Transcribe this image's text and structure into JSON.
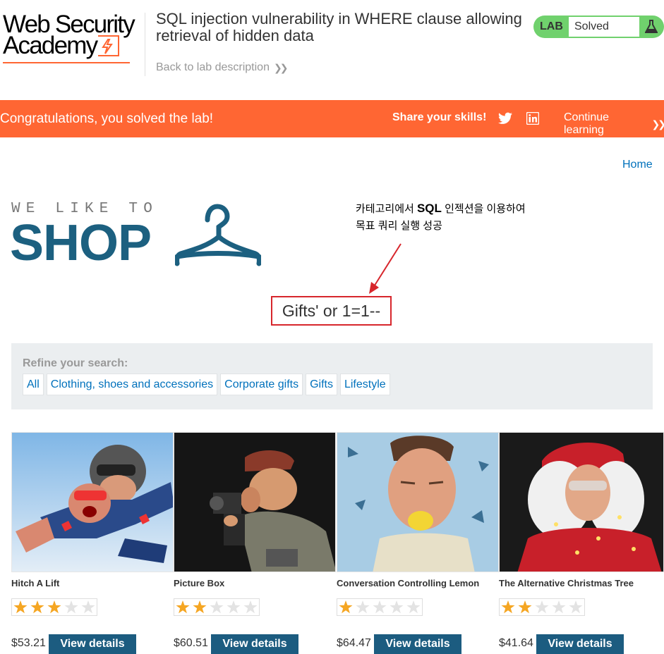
{
  "header": {
    "logo_line1": "Web Security",
    "logo_line2": "Academy",
    "lab_title": "SQL injection vulnerability in WHERE clause allowing retrieval of hidden data",
    "back_link": "Back to lab description",
    "lab_badge": "LAB",
    "lab_state": "Solved"
  },
  "banner": {
    "message": "Congratulations, you solved the lab!",
    "share": "Share your skills!",
    "continue": "Continue learning"
  },
  "nav": {
    "home": "Home"
  },
  "hero": {
    "tagline": "WE LIKE TO",
    "title": "SHOP"
  },
  "annotation": {
    "line1_pre": "카테고리에서 ",
    "line1_bold": "SQL",
    "line1_post": " 인젝션을 이용하여",
    "line2": "목표 쿼리 실행 성공"
  },
  "search": {
    "title": "Gifts' or 1=1--"
  },
  "filters": {
    "label": "Refine your search:",
    "items": [
      "All",
      "Clothing, shoes and accessories",
      "Corporate gifts",
      "Gifts",
      "Lifestyle"
    ]
  },
  "colors": {
    "brand_orange": "#ff6633",
    "lab_green": "#70d16d",
    "link_blue": "#0071bc",
    "button_blue": "#1c5c80",
    "annotation_red": "#d7262c",
    "star_gold": "#f5a623"
  },
  "products": [
    {
      "name": "Hitch A Lift",
      "rating": 3,
      "price": "$53.21",
      "button": "View details"
    },
    {
      "name": "Picture Box",
      "rating": 2,
      "price": "$60.51",
      "button": "View details"
    },
    {
      "name": "Conversation Controlling Lemon",
      "rating": 1,
      "price": "$64.47",
      "button": "View details"
    },
    {
      "name": "The Alternative Christmas Tree",
      "rating": 2,
      "price": "$41.64",
      "button": "View details"
    }
  ],
  "icons": {
    "back_chevron": "chevron-double-right-icon",
    "flask": "flask-icon",
    "twitter": "twitter-icon",
    "linkedin": "linkedin-icon",
    "hanger": "hanger-icon",
    "star": "star-icon"
  }
}
